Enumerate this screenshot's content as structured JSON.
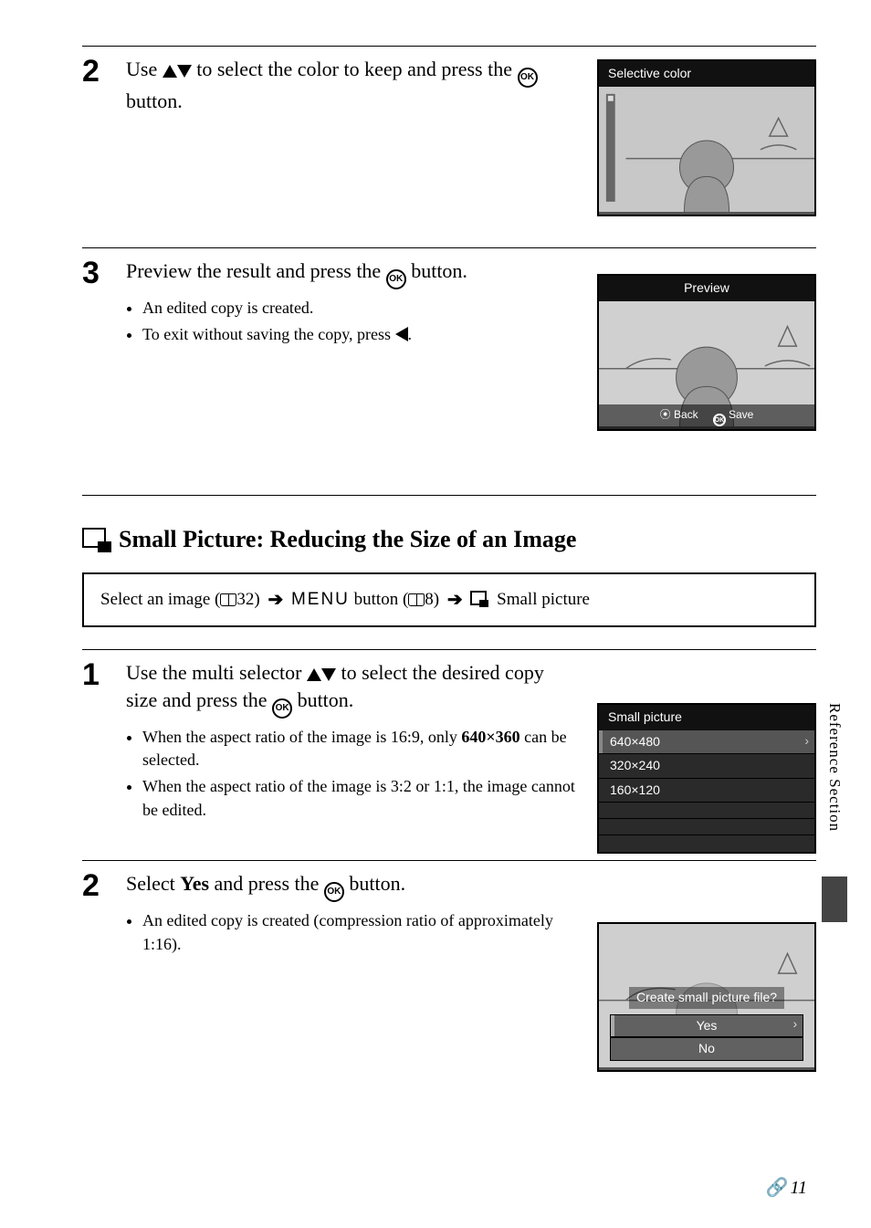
{
  "side_tab": "Reference Section",
  "page_number": "11",
  "steps_a": [
    {
      "num": "2",
      "head_prefix": "Use ",
      "head_suffix": " to select the color to keep and press the ",
      "head_end": " button.",
      "bullets": [],
      "lcd": {
        "header": "Selective color"
      }
    },
    {
      "num": "3",
      "head_prefix": "Preview the result and press the ",
      "head_suffix": "",
      "head_end": " button.",
      "bullets": [
        "An edited copy is created.",
        "To exit without saving the copy, press "
      ],
      "lcd": {
        "header": "Preview",
        "back": "Back",
        "save": "Save"
      }
    }
  ],
  "section_title": "Small Picture: Reducing the Size of an Image",
  "nav": {
    "pre": "Select an image (",
    "ref1": "32",
    "mid1": ") ",
    "menu": "MENU",
    "mid2": " button (",
    "ref2": "8",
    "mid3": ") ",
    "tail": " Small picture"
  },
  "steps_b": [
    {
      "num": "1",
      "head_prefix": "Use the multi selector ",
      "head_suffix": " to select the desired copy size and press the ",
      "head_end": " button.",
      "bullets": [
        "When the aspect ratio of the image is 16:9, only 640×360 can be selected.",
        "When the aspect ratio of the image is 3:2 or 1:1, the image cannot be edited."
      ],
      "bold_in_bullet0": "640×360",
      "lcd": {
        "header": "Small picture",
        "items": [
          "640×480",
          "320×240",
          "160×120"
        ]
      }
    },
    {
      "num": "2",
      "head_prefix": "Select ",
      "head_bold": "Yes",
      "head_suffix": " and press the ",
      "head_end": " button.",
      "bullets": [
        "An edited copy is created (compression ratio of approximately 1:16)."
      ],
      "lcd": {
        "question": "Create small picture file?",
        "yes": "Yes",
        "no": "No"
      }
    }
  ]
}
